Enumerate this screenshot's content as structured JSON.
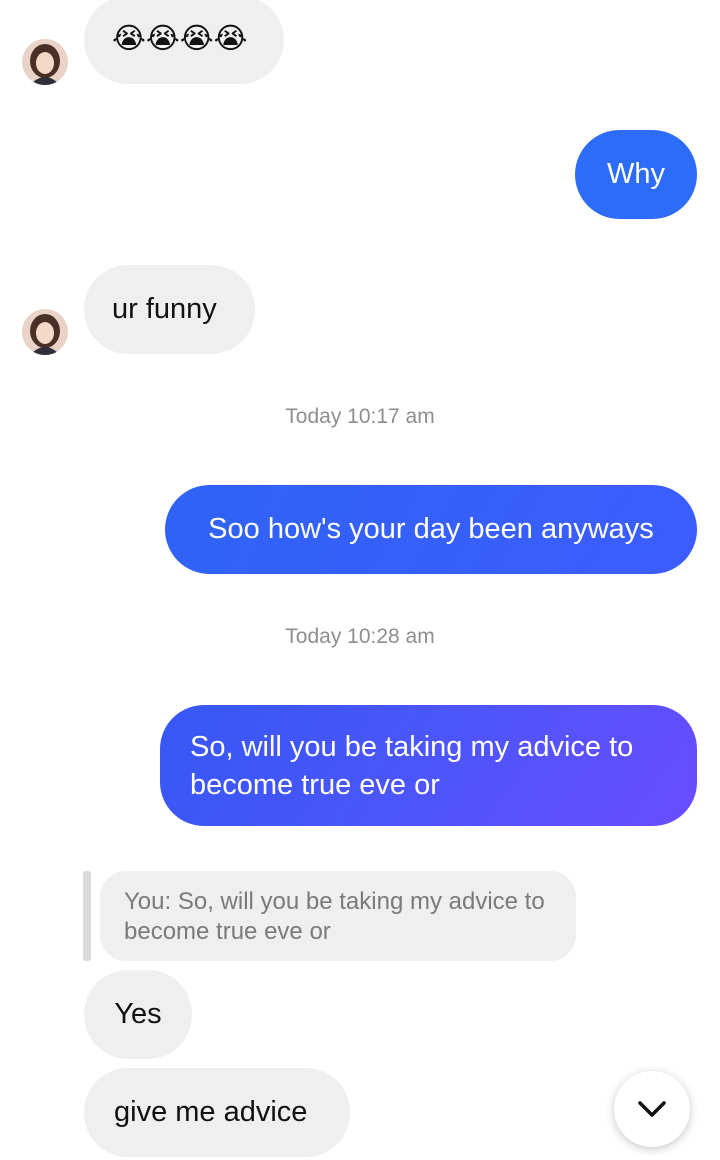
{
  "messages": [
    {
      "id": "m1",
      "from": "them",
      "text": "😭😭😭😭"
    },
    {
      "id": "m2",
      "from": "me",
      "text": "Why"
    },
    {
      "id": "m3",
      "from": "them",
      "text": "ur funny"
    },
    {
      "id": "ts1",
      "type": "timestamp",
      "text": "Today 10:17 am"
    },
    {
      "id": "m4",
      "from": "me",
      "text": "Soo how's your day been anyways"
    },
    {
      "id": "ts2",
      "type": "timestamp",
      "text": "Today 10:28 am"
    },
    {
      "id": "m5",
      "from": "me",
      "text_line1": "So, will you be taking my advice to",
      "text_line2": "become true eve or"
    },
    {
      "id": "q1",
      "type": "reply-quote",
      "text": "You: So, will you be taking my advice to become true eve or"
    },
    {
      "id": "m6",
      "from": "them",
      "text": "Yes"
    },
    {
      "id": "m7",
      "from": "them",
      "text": "give me advice"
    }
  ],
  "colors": {
    "outgoing_blue": "#2c6bf7",
    "outgoing_purple": "#6a4cff",
    "incoming_bg": "#efefef",
    "timestamp": "#8e8e8e"
  },
  "icons": {
    "avatar": "contact-avatar-icon",
    "scroll_down": "chevron-down-icon"
  }
}
